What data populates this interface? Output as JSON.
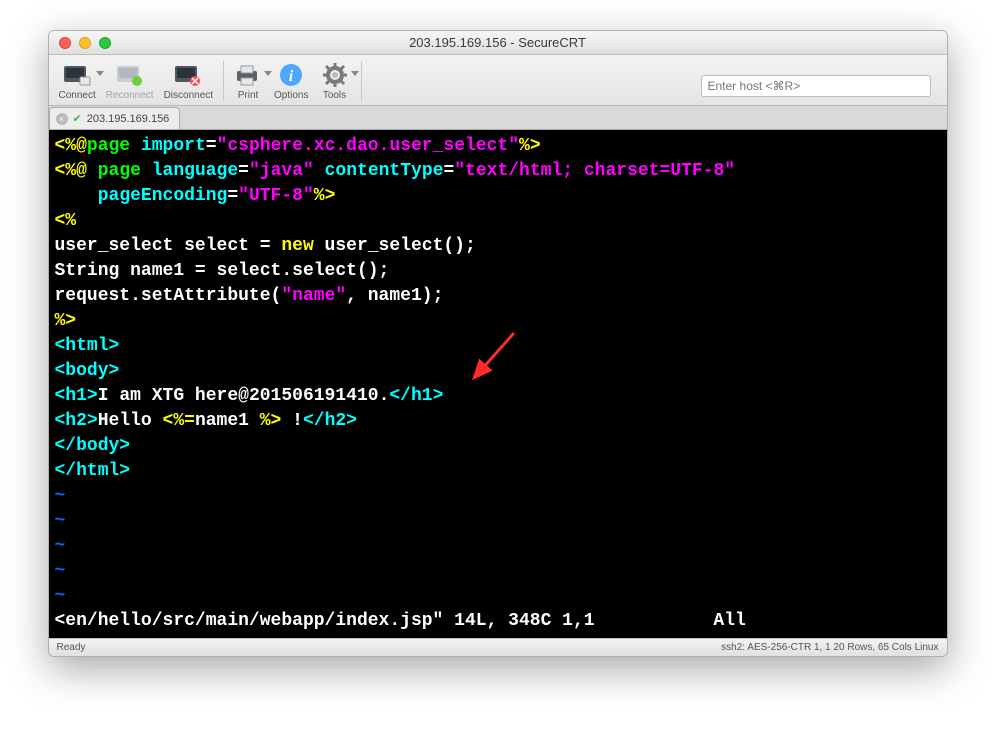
{
  "window": {
    "title": "203.195.169.156 - SecureCRT"
  },
  "toolbar": {
    "connect": "Connect",
    "reconnect": "Reconnect",
    "disconnect": "Disconnect",
    "print": "Print",
    "options": "Options",
    "tools": "Tools"
  },
  "hostInput": {
    "placeholder": "Enter host <⌘R>"
  },
  "tab": {
    "label": "203.195.169.156"
  },
  "code": {
    "l1": {
      "a": "<%@",
      "b": "page",
      "c": "import",
      "d": "=",
      "e": "\"csphere.xc.dao.user_select\"",
      "f": "%>"
    },
    "l2": {
      "a": "<%@",
      "b": "page",
      "c": "language",
      "d": "=",
      "e": "\"java\"",
      "f": "contentType",
      "g": "=",
      "h": "\"text/html; charset=UTF-8\""
    },
    "l3": {
      "a": "pageEncoding",
      "b": "=",
      "c": "\"UTF-8\"",
      "d": "%>"
    },
    "l4": {
      "a": "<%"
    },
    "l5": {
      "a": "user_select select = ",
      "b": "new",
      "c": " user_select();"
    },
    "l6": {
      "a": "String name1 = select.select();"
    },
    "l7": {
      "a": "request.setAttribute(",
      "b": "\"name\"",
      "c": ", name1);"
    },
    "l8": {
      "a": "%>"
    },
    "l9": {
      "a": "<html>"
    },
    "l10": {
      "a": "<body>"
    },
    "l11": {
      "a": "<h1>",
      "b": "I am XTG here@201506191410.",
      "c": "</h1>"
    },
    "l12": {
      "a": "<h2>",
      "b": "Hello ",
      "c": "<%=",
      "d": "name1 ",
      "e": "%>",
      "f": " !",
      "g": "</h2>"
    },
    "l13": {
      "a": "</body>"
    },
    "l14": {
      "a": "</html>"
    },
    "tilde": "~",
    "footer": "<en/hello/src/main/webapp/index.jsp\" 14L, 348C 1,1           All"
  },
  "status": {
    "left": "Ready",
    "right": "ssh2: AES-256-CTR    1, 1   20 Rows, 65 Cols   Linux"
  }
}
